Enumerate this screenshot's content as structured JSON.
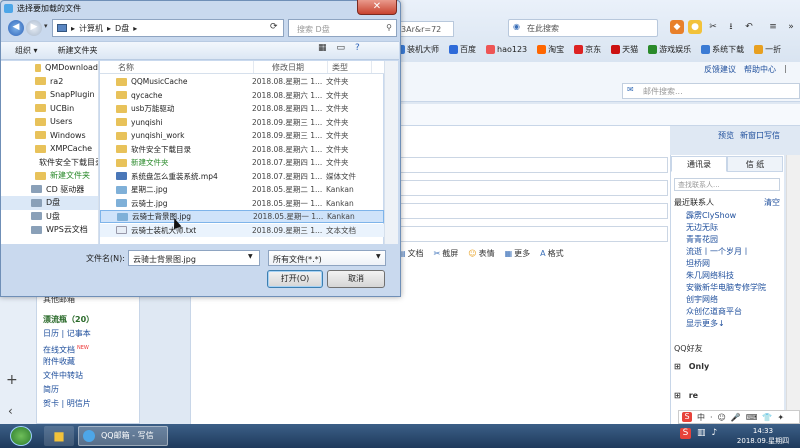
{
  "browser": {
    "url_fragment": "3Ar&r=72",
    "search_placeholder": "在此搜索",
    "bookmarks": [
      {
        "label": "装机大师",
        "color": "#3b7bd4"
      },
      {
        "label": "百度",
        "color": "#2f6bd9"
      },
      {
        "label": "hao123",
        "color": "#e55"
      },
      {
        "label": "淘宝",
        "color": "#f60"
      },
      {
        "label": "京东",
        "color": "#d22"
      },
      {
        "label": "天猫",
        "color": "#c11"
      },
      {
        "label": "游戏娱乐",
        "color": "#2a8a2a"
      },
      {
        "label": "系统下载",
        "color": "#3b7bd4"
      },
      {
        "label": "一折",
        "color": "#e8a020"
      }
    ]
  },
  "mail": {
    "top_links": [
      "反馈建议",
      "帮助中心"
    ],
    "search_placeholder": "邮件搜索...",
    "preview_links": [
      "预览",
      "新窗口写信"
    ],
    "format_bar": [
      "文档",
      "截屏",
      "表情",
      "更多",
      "格式"
    ],
    "left_nav": {
      "section": "其他邮箱",
      "items": [
        "漂流瓶（20）",
        "日历 | 记事本",
        "在线文档",
        "附件收藏",
        "文件中转站",
        "简历",
        "贺卡 | 明信片"
      ],
      "new_badge": "NEW"
    },
    "contacts": {
      "tabs": [
        "通讯录",
        "信 纸"
      ],
      "search_placeholder": "查找联系人...",
      "recent_label": "最近联系人",
      "clear_label": "清空",
      "recent": [
        "霹雳ClyShow",
        "无边无际",
        "青青花园",
        "流逝丨一个岁月丨",
        "坦桥网",
        "朱几网络科技",
        "安徽新华电脑专修学院",
        "创宇网络",
        "众创亿道商平台",
        "显示更多↓"
      ],
      "qq_friends": "QQ好友",
      "groups": [
        "Only",
        "re"
      ]
    }
  },
  "dialog": {
    "title": "选择要加载的文件",
    "close_label": "✕",
    "breadcrumb": [
      "计算机",
      "D盘"
    ],
    "search_placeholder": "搜索 D盘",
    "toolbar": {
      "organize": "组织",
      "new_folder": "新建文件夹"
    },
    "nav_items": [
      {
        "label": "QMDownload",
        "type": "folder"
      },
      {
        "label": "ra2",
        "type": "folder"
      },
      {
        "label": "SnapPlugin",
        "type": "folder"
      },
      {
        "label": "UCBin",
        "type": "folder"
      },
      {
        "label": "Users",
        "type": "folder"
      },
      {
        "label": "Windows",
        "type": "folder"
      },
      {
        "label": "XMPCache",
        "type": "folder"
      },
      {
        "label": "软件安全下载目录",
        "type": "folder"
      },
      {
        "label": "新建文件夹",
        "type": "folder"
      },
      {
        "label": "CD 驱动器",
        "type": "drive"
      },
      {
        "label": "D盘",
        "type": "drive"
      },
      {
        "label": "U盘",
        "type": "drive"
      },
      {
        "label": "WPS云文档",
        "type": "drive"
      }
    ],
    "columns": {
      "name": "名称",
      "date": "修改日期",
      "type": "类型"
    },
    "files": [
      {
        "name": "QQMusicCache",
        "date": "2018.08.星期二 1...",
        "type": "文件夹",
        "kind": "folder"
      },
      {
        "name": "qycache",
        "date": "2018.08.星期六 1...",
        "type": "文件夹",
        "kind": "folder"
      },
      {
        "name": "usb万能驱动",
        "date": "2018.08.星期四 1...",
        "type": "文件夹",
        "kind": "folder"
      },
      {
        "name": "yunqishi",
        "date": "2018.09.星期三 1...",
        "type": "文件夹",
        "kind": "folder"
      },
      {
        "name": "yunqishi_work",
        "date": "2018.09.星期三 1...",
        "type": "文件夹",
        "kind": "folder"
      },
      {
        "name": "软件安全下载目录",
        "date": "2018.08.星期六 1...",
        "type": "文件夹",
        "kind": "folder"
      },
      {
        "name": "新建文件夹",
        "date": "2018.07.星期四 1...",
        "type": "文件夹",
        "kind": "folder"
      },
      {
        "name": "系统盘怎么重装系统.mp4",
        "date": "2018.07.星期四 1...",
        "type": "媒体文件",
        "kind": "vid"
      },
      {
        "name": "星期二.jpg",
        "date": "2018.05.星期二 1...",
        "type": "Kankan",
        "kind": "img"
      },
      {
        "name": "云骑士.jpg",
        "date": "2018.05.星期一 1...",
        "type": "Kankan",
        "kind": "img"
      },
      {
        "name": "云骑士背景图.jpg",
        "date": "2018.05.星期一 1...",
        "type": "Kankan",
        "kind": "img"
      },
      {
        "name": "云骑士装机大师.txt",
        "date": "2018.09.星期三 1...",
        "type": "文本文档",
        "kind": "doc"
      }
    ],
    "filename_label": "文件名(N):",
    "filename_value": "云骑士背景图.jpg",
    "filetype_value": "所有文件(*.*)",
    "open_label": "打开(O)",
    "cancel_label": "取消"
  },
  "taskbar": {
    "active_window": "QQ邮箱 - 写信",
    "time": "14:33",
    "date": "2018.09.星期四"
  },
  "ime": {
    "labels": [
      "中",
      "·",
      "☺",
      "🎤",
      "⌨",
      "👕",
      "✦"
    ]
  }
}
